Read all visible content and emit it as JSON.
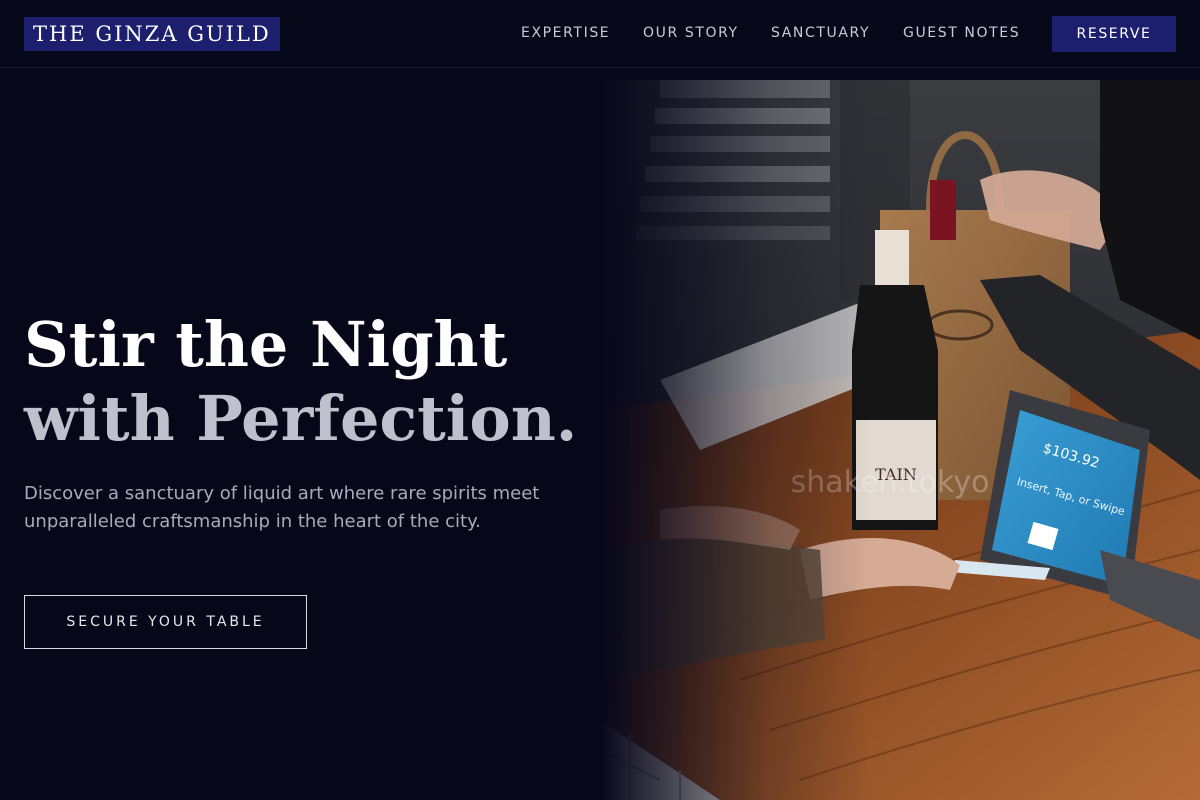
{
  "brand": {
    "name": "THE GINZA GUILD"
  },
  "nav": {
    "links": [
      "EXPERTISE",
      "OUR STORY",
      "SANCTUARY",
      "GUEST NOTES"
    ],
    "reserve_label": "RESERVE"
  },
  "hero": {
    "title_line1": "Stir the Night",
    "title_line2": "with Perfection.",
    "description": "Discover a sanctuary of liquid art where rare spirits meet unparalleled craftsmanship in the heart of the city.",
    "cta_label": "SECURE YOUR TABLE"
  },
  "photo": {
    "watermark": "shaken.tokyo",
    "screen_amount": "$103.92",
    "screen_prompt": "Insert, Tap, or Swipe",
    "bottle_label": "TAIN"
  },
  "colors": {
    "background": "#07071a",
    "accent": "#1b1f6e",
    "muted_text": "#a9aab8"
  }
}
